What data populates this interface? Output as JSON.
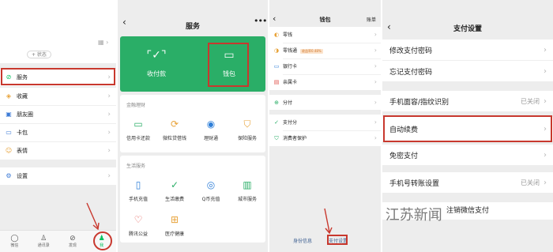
{
  "colors": {
    "wechat_green": "#2aae67",
    "annotation_red": "#c8382e",
    "link_blue": "#3d5f91"
  },
  "me_screen": {
    "qr_icon": "qr-code-icon",
    "status_button": "+ 状态",
    "menu": [
      {
        "label": "服务",
        "icon": "services-icon",
        "highlighted": true
      },
      {
        "label": "收藏",
        "icon": "favorites-icon"
      },
      {
        "label": "朋友圈",
        "icon": "moments-icon"
      },
      {
        "label": "卡包",
        "icon": "card-pack-icon"
      },
      {
        "label": "表情",
        "icon": "sticker-icon"
      },
      {
        "label": "设置",
        "icon": "settings-icon"
      }
    ],
    "tabs": [
      {
        "label": "微信",
        "icon": "chat-icon"
      },
      {
        "label": "通讯录",
        "icon": "contacts-icon"
      },
      {
        "label": "发现",
        "icon": "discover-icon"
      },
      {
        "label": "我",
        "icon": "me-icon",
        "active": true
      }
    ]
  },
  "services_screen": {
    "title": "服务",
    "green_panel": [
      {
        "label": "收付款",
        "icon": "scan-pay-icon"
      },
      {
        "label": "钱包",
        "icon": "wallet-icon",
        "highlighted": true
      }
    ],
    "finance": {
      "title": "金融理财",
      "items": [
        {
          "label": "信用卡还款",
          "icon": "credit-card-icon"
        },
        {
          "label": "微粒贷借钱",
          "icon": "loan-icon"
        },
        {
          "label": "理财通",
          "icon": "wealth-icon"
        },
        {
          "label": "保险服务",
          "icon": "insurance-icon"
        }
      ]
    },
    "life": {
      "title": "生活服务",
      "items": [
        {
          "label": "手机充值",
          "icon": "phone-topup-icon"
        },
        {
          "label": "生活缴费",
          "icon": "utility-icon"
        },
        {
          "label": "Q币充值",
          "icon": "qcoin-icon"
        },
        {
          "label": "城市服务",
          "icon": "city-icon"
        },
        {
          "label": "腾讯公益",
          "icon": "charity-icon"
        },
        {
          "label": "医疗健康",
          "icon": "health-icon"
        }
      ]
    }
  },
  "wallet_screen": {
    "title": "钱包",
    "bill_link": "账单",
    "group1": [
      {
        "label": "零钱",
        "icon": "change-icon"
      },
      {
        "label": "零钱通",
        "icon": "change-plus-icon",
        "badge": "收益率0.48%"
      },
      {
        "label": "银行卡",
        "icon": "bank-card-icon"
      },
      {
        "label": "亲属卡",
        "icon": "family-card-icon"
      }
    ],
    "group2": [
      {
        "label": "分付",
        "icon": "fenfu-icon"
      }
    ],
    "group3": [
      {
        "label": "支付分",
        "icon": "pay-score-icon"
      },
      {
        "label": "消费者保护",
        "icon": "consumer-protect-icon"
      }
    ],
    "bottom_links": [
      "身份信息",
      "支付设置"
    ]
  },
  "payment_settings_screen": {
    "title": "支付设置",
    "rows": [
      {
        "label": "修改支付密码",
        "value": ""
      },
      {
        "label": "忘记支付密码",
        "value": ""
      },
      {
        "label": "手机面容/指纹识别",
        "value": "已关闭"
      },
      {
        "label": "自动续费",
        "value": "",
        "highlighted": true
      },
      {
        "label": "免密支付",
        "value": ""
      },
      {
        "label": "手机号转账设置",
        "value": "已关闭"
      }
    ],
    "cancel_label": "注销微信支付"
  },
  "watermark": "公众号 · 江苏新闻"
}
